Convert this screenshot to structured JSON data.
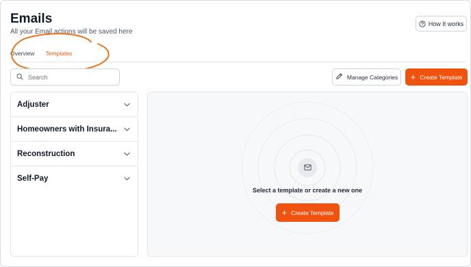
{
  "header": {
    "title": "Emails",
    "subtitle": "All your Email actions will be saved here",
    "help_button": {
      "label": "How It works",
      "icon": "help-circle-icon"
    }
  },
  "tabs": [
    {
      "label": "Overview",
      "active": false
    },
    {
      "label": "Templates",
      "active": true
    }
  ],
  "toolbar": {
    "search": {
      "placeholder": "Search",
      "value": "",
      "icon": "search-icon"
    },
    "manage_button": {
      "label": "Manage Categories",
      "icon": "pencil-icon"
    },
    "create_button": {
      "label": "Create Template",
      "icon": "plus-icon"
    }
  },
  "categories": [
    {
      "label": "Adjuster"
    },
    {
      "label": "Homeowners with Insura..."
    },
    {
      "label": "Reconstruction"
    },
    {
      "label": "Self-Pay"
    }
  ],
  "empty_state": {
    "icon": "mail-icon",
    "message": "Select a template or create a new one",
    "button_label": "Create Template"
  },
  "colors": {
    "accent": "#f0530f",
    "annotation": "#e8731a",
    "active_tab": "#ea580c"
  }
}
